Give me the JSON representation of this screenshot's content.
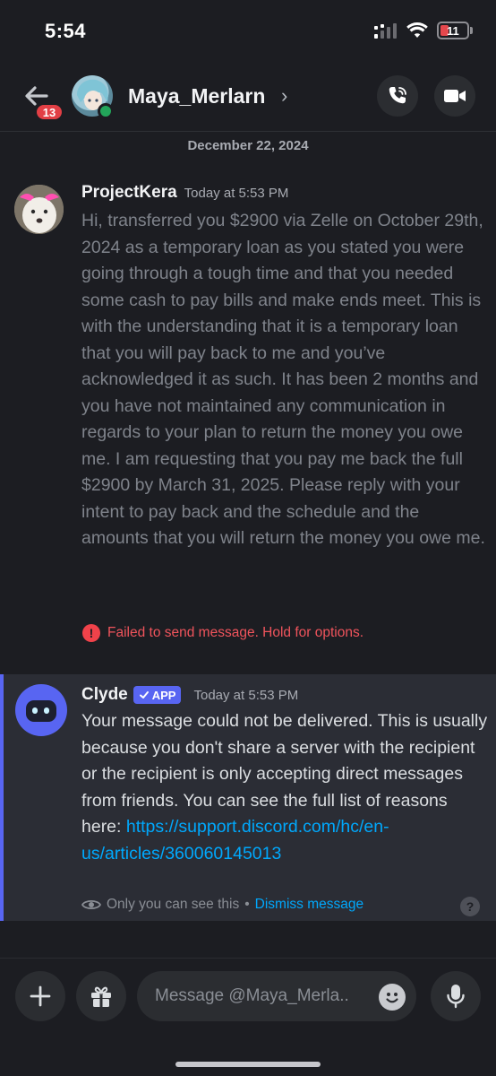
{
  "status_bar": {
    "time": "5:54",
    "battery": "11"
  },
  "header": {
    "unread_count": "13",
    "contact_name": "Maya_Merlarn",
    "chevron": "›",
    "icons": {
      "back": "arrow-left-icon",
      "call": "phone-call-icon",
      "video": "video-camera-icon"
    }
  },
  "conversation": {
    "date_separator": "December 22, 2024",
    "messages": [
      {
        "author": "ProjectKera",
        "timestamp": "Today at 5:53 PM",
        "text": "Hi, transferred you $2900 via Zelle on October 29th, 2024 as a temporary loan as you stated you were going through a tough time and that you needed some cash to pay bills and make ends meet. This is with the understanding that it is a temporary loan that you will pay back to me and you’ve acknowledged it as such. It has been 2 months and you have not maintained any communication in regards to your plan to return the money you owe me. I am requesting that you pay me back the full $2900 by March 31, 2025. Please reply with your intent to pay back and the schedule and the amounts that you will return the money you owe me.",
        "error": "Failed to send message. Hold for options."
      },
      {
        "author": "Clyde",
        "badge": "APP",
        "timestamp": "Today at 5:53 PM",
        "text": "Your message could not be delivered. This is usually because you don't share a server with the recipient or the recipient is only accepting direct messages from friends. You can see the full list of reasons here: ",
        "link": "https://support.discord.com/hc/en-us/articles/360060145013",
        "visibility_note": "Only you can see this",
        "separator": " • ",
        "dismiss_label": "Dismiss message"
      }
    ]
  },
  "composer": {
    "placeholder": "Message @Maya_Merla.."
  },
  "colors": {
    "accent": "#5865f2",
    "error": "#f0424a",
    "link": "#00a8fc",
    "online": "#23a55a",
    "background": "#1c1d22"
  }
}
